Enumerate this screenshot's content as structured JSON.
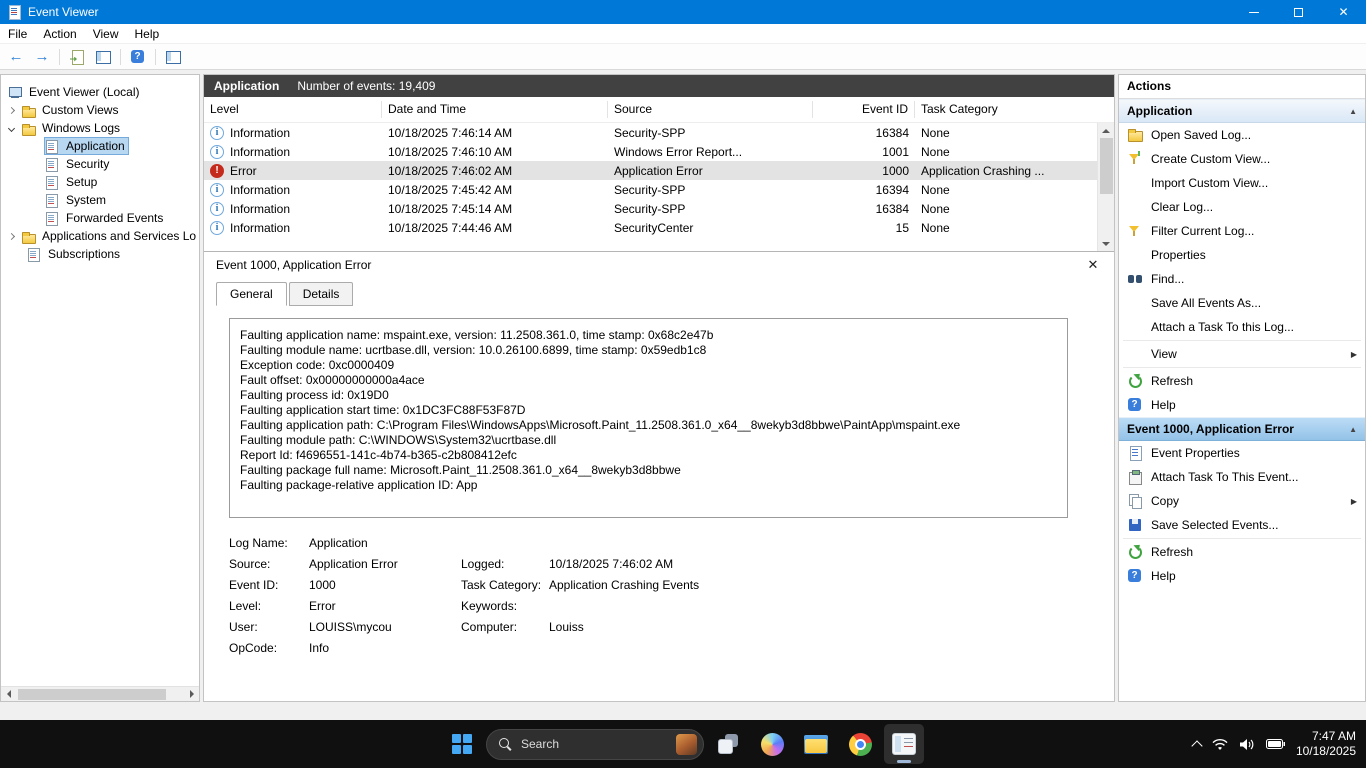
{
  "titlebar": {
    "title": "Event Viewer"
  },
  "menubar": {
    "items": [
      "File",
      "Action",
      "View",
      "Help"
    ]
  },
  "tree": {
    "root": "Event Viewer (Local)",
    "custom_views": "Custom Views",
    "windows_logs": "Windows Logs",
    "application": "Application",
    "security": "Security",
    "setup": "Setup",
    "system": "System",
    "forwarded_events": "Forwarded Events",
    "apps_services": "Applications and Services Lo",
    "subscriptions": "Subscriptions"
  },
  "main": {
    "log_name": "Application",
    "events_count": "Number of events: 19,409",
    "columns": [
      "Level",
      "Date and Time",
      "Source",
      "Event ID",
      "Task Category"
    ],
    "rows": [
      {
        "level": "Information",
        "datetime": "10/18/2025 7:46:14 AM",
        "source": "Security-SPP",
        "event_id": "16384",
        "task": "None"
      },
      {
        "level": "Information",
        "datetime": "10/18/2025 7:46:10 AM",
        "source": "Windows Error Report...",
        "event_id": "1001",
        "task": "None"
      },
      {
        "level": "Error",
        "datetime": "10/18/2025 7:46:02 AM",
        "source": "Application Error",
        "event_id": "1000",
        "task": "Application Crashing ..."
      },
      {
        "level": "Information",
        "datetime": "10/18/2025 7:45:42 AM",
        "source": "Security-SPP",
        "event_id": "16394",
        "task": "None"
      },
      {
        "level": "Information",
        "datetime": "10/18/2025 7:45:14 AM",
        "source": "Security-SPP",
        "event_id": "16384",
        "task": "None"
      },
      {
        "level": "Information",
        "datetime": "10/18/2025 7:44:46 AM",
        "source": "SecurityCenter",
        "event_id": "15",
        "task": "None"
      }
    ]
  },
  "detail": {
    "title": "Event 1000, Application Error",
    "tab_general": "General",
    "tab_details": "Details",
    "description": [
      "Faulting application name: mspaint.exe, version: 11.2508.361.0, time stamp: 0x68c2e47b",
      "Faulting module name: ucrtbase.dll, version: 10.0.26100.6899, time stamp: 0x59edb1c8",
      "Exception code: 0xc0000409",
      "Fault offset: 0x00000000000a4ace",
      "Faulting process id: 0x19D0",
      "Faulting application start time: 0x1DC3FC88F53F87D",
      "Faulting application path: C:\\Program Files\\WindowsApps\\Microsoft.Paint_11.2508.361.0_x64__8wekyb3d8bbwe\\PaintApp\\mspaint.exe",
      "Faulting module path: C:\\WINDOWS\\System32\\ucrtbase.dll",
      "Report Id: f4696551-141c-4b74-b365-c2b808412efc",
      "Faulting package full name: Microsoft.Paint_11.2508.361.0_x64__8wekyb3d8bbwe",
      "Faulting package-relative application ID: App"
    ],
    "fields": {
      "log_name_label": "Log Name:",
      "log_name": "Application",
      "source_label": "Source:",
      "source": "Application Error",
      "logged_label": "Logged:",
      "logged": "10/18/2025 7:46:02 AM",
      "event_id_label": "Event ID:",
      "event_id": "1000",
      "task_label": "Task Category:",
      "task": "Application Crashing Events",
      "level_label": "Level:",
      "level": "Error",
      "keywords_label": "Keywords:",
      "keywords": "",
      "user_label": "User:",
      "user": "LOUISS\\mycou",
      "computer_label": "Computer:",
      "computer": "Louiss",
      "opcode_label": "OpCode:",
      "opcode": "Info"
    }
  },
  "actions": {
    "title": "Actions",
    "section_application": "Application",
    "app_items": [
      "Open Saved Log...",
      "Create Custom View...",
      "Import Custom View...",
      "Clear Log...",
      "Filter Current Log...",
      "Properties",
      "Find...",
      "Save All Events As...",
      "Attach a Task To this Log...",
      "View",
      "Refresh",
      "Help"
    ],
    "section_event": "Event 1000, Application Error",
    "event_items": [
      "Event Properties",
      "Attach Task To This Event...",
      "Copy",
      "Save Selected Events...",
      "Refresh",
      "Help"
    ]
  },
  "taskbar": {
    "search_label": "Search",
    "time": "7:47 AM",
    "date": "10/18/2025"
  }
}
